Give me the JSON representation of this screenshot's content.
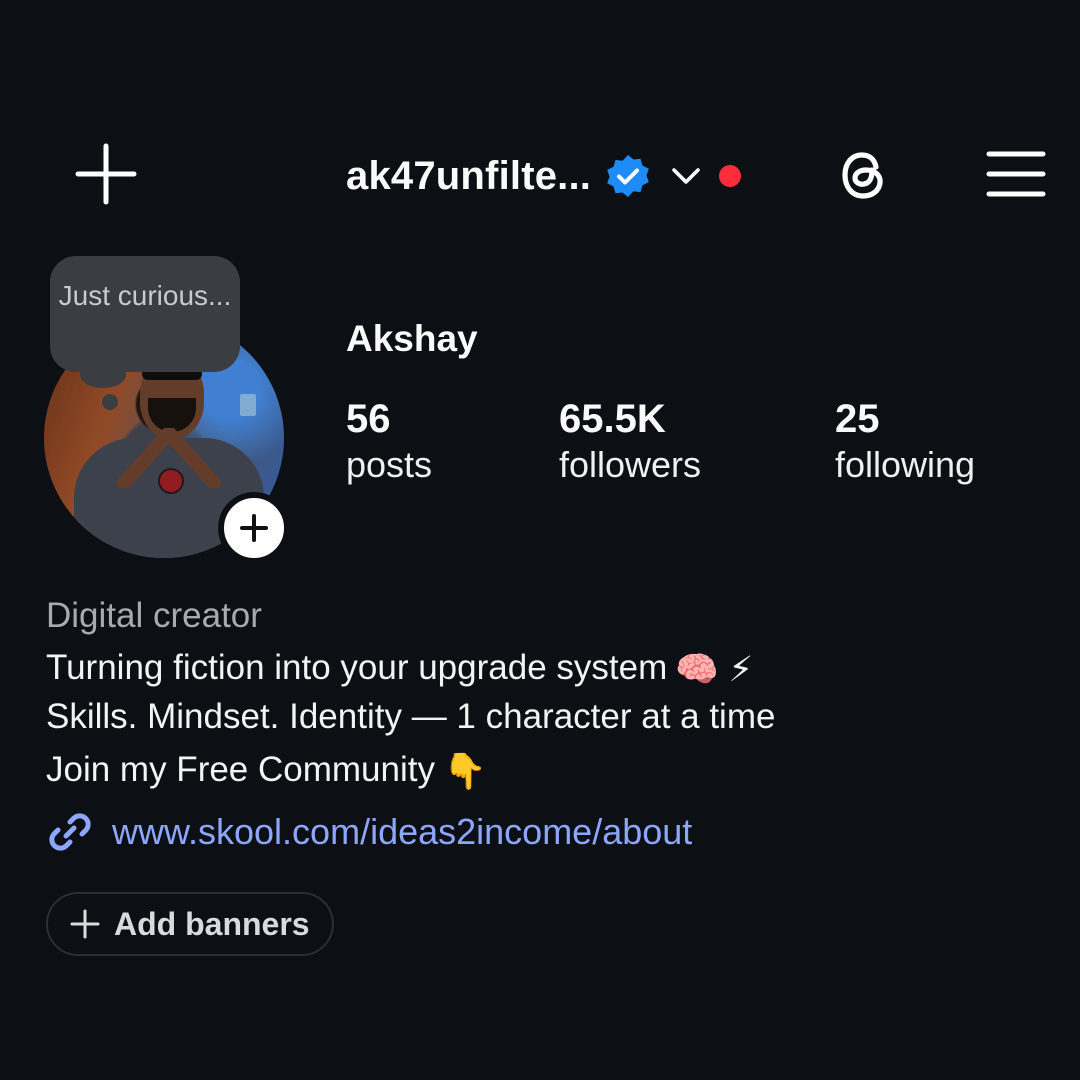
{
  "header": {
    "username": "ak47unfilte...",
    "verified_icon": "verified-badge-icon",
    "dropdown_icon": "chevron-down-icon",
    "notification_dot_color": "#ff2d3c",
    "left_icon": "plus-icon",
    "threads_icon": "threads-icon",
    "menu_icon": "hamburger-menu-icon"
  },
  "profile": {
    "note": "Just curious...",
    "name": "Akshay",
    "stats": {
      "posts_count": "56",
      "posts_label": "posts",
      "followers_count": "65.5K",
      "followers_label": "followers",
      "following_count": "25",
      "following_label": "following"
    }
  },
  "bio": {
    "category": "Digital creator",
    "line1": "Turning fiction into your upgrade system",
    "line1_emojis": "🧠 ⚡",
    "line2": "Skills. Mindset. Identity — 1 character at a time",
    "line3": "Join my Free Community",
    "line3_emoji": "👇",
    "link": "www.skool.com/ideas2income/about"
  },
  "actions": {
    "add_banners": "Add banners"
  },
  "colors": {
    "background": "#0c0f14",
    "link": "#8da6ff",
    "verified": "#1d8cf8"
  }
}
